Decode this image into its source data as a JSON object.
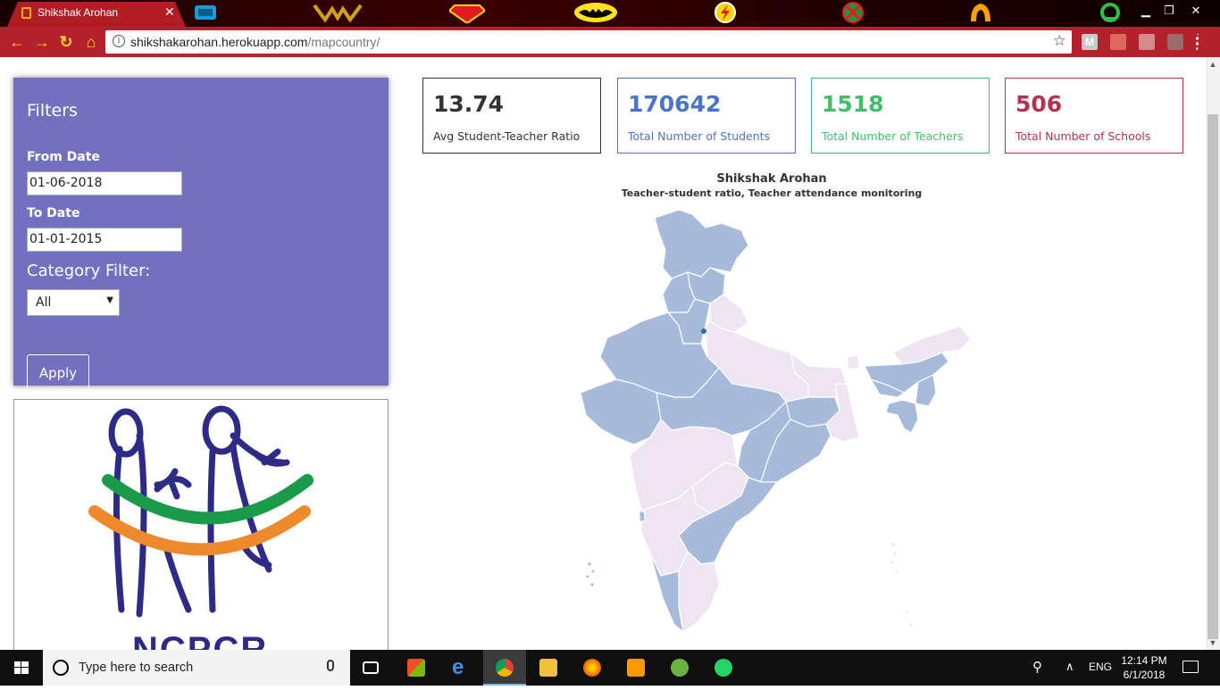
{
  "browser": {
    "tab_title": "Shikshak Arohan",
    "url_host": "shikshakarohan.herokuapp.com",
    "url_path": "/mapcountry/"
  },
  "filters": {
    "title": "Filters",
    "from_label": "From Date",
    "from_value": "01-06-2018",
    "to_label": "To Date",
    "to_value": "01-01-2015",
    "category_label": "Category Filter:",
    "category_value": "All",
    "apply_label": "Apply"
  },
  "logo": {
    "text": "NCPCR"
  },
  "stats": [
    {
      "value": "13.74",
      "label": "Avg Student-Teacher Ratio",
      "color": "#333333"
    },
    {
      "value": "170642",
      "label": "Total Number of Students",
      "color": "#4a73c9"
    },
    {
      "value": "1518",
      "label": "Total Number of Teachers",
      "color": "#3fbf6b"
    },
    {
      "value": "506",
      "label": "Total Number of Schools",
      "color": "#b5314e"
    }
  ],
  "map": {
    "title": "Shikshak Arohan",
    "subtitle": "Teacher-student ratio, Teacher attendance monitoring",
    "colors": {
      "high": "#a6bbdb",
      "low": "#ede6f2",
      "border": "#ffffff"
    }
  },
  "taskbar": {
    "search_placeholder": "Type here to search",
    "language": "ENG",
    "time": "12:14 PM",
    "date": "6/1/2018"
  }
}
